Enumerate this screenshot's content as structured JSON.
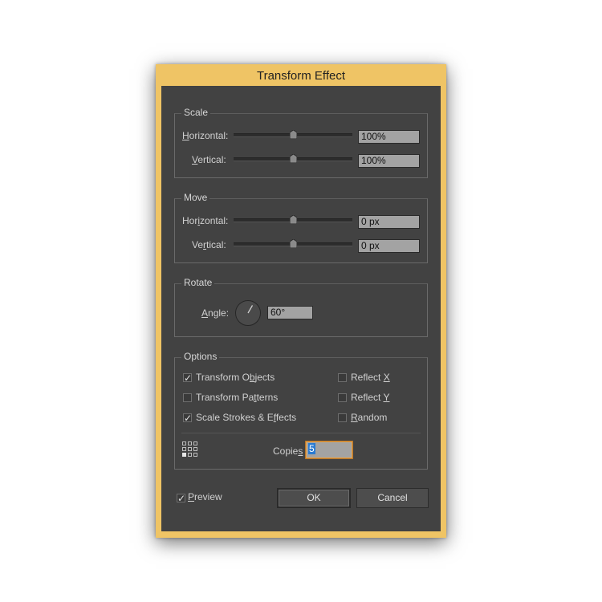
{
  "dialog": {
    "title": "Transform Effect"
  },
  "scale": {
    "legend": "Scale",
    "horizontal": {
      "label_ul": "H",
      "label_rest": "orizontal:",
      "value": "100%",
      "slider": 0.5
    },
    "vertical": {
      "label_ul": "V",
      "label_rest": "ertical:",
      "value": "100%",
      "slider": 0.5
    }
  },
  "move": {
    "legend": "Move",
    "horizontal": {
      "label_pre": "Hor",
      "label_ul": "i",
      "label_rest": "zontal:",
      "value": "0 px",
      "slider": 0.5
    },
    "vertical": {
      "label_pre": "Ve",
      "label_ul": "r",
      "label_rest": "tical:",
      "value": "0 px",
      "slider": 0.5
    }
  },
  "rotate": {
    "legend": "Rotate",
    "angle_ul": "A",
    "angle_rest": "ngle:",
    "value": "60°",
    "degrees": 60
  },
  "options": {
    "legend": "Options",
    "transform_objects": {
      "pre": "Transform O",
      "ul": "b",
      "rest": "jects",
      "checked": true
    },
    "transform_patterns": {
      "pre": "Transform Pa",
      "ul": "t",
      "rest": "terns",
      "checked": false
    },
    "scale_strokes": {
      "pre": "Scale Strokes & E",
      "ul": "f",
      "rest": "fects",
      "checked": true
    },
    "reflect_x": {
      "pre": "Reflect ",
      "ul": "X",
      "rest": "",
      "checked": false
    },
    "reflect_y": {
      "pre": "Reflect ",
      "ul": "Y",
      "rest": "",
      "checked": false
    },
    "random": {
      "pre": "",
      "ul": "R",
      "rest": "andom",
      "checked": false
    },
    "copies_pre": "Copie",
    "copies_ul": "s",
    "copies_value": "5"
  },
  "preview": {
    "ul": "P",
    "rest": "review",
    "checked": true
  },
  "buttons": {
    "ok": "OK",
    "cancel": "Cancel"
  },
  "colors": {
    "accent": "#efc465",
    "panel": "#424242",
    "field": "#a3a3a3",
    "focus": "#e8a040"
  }
}
